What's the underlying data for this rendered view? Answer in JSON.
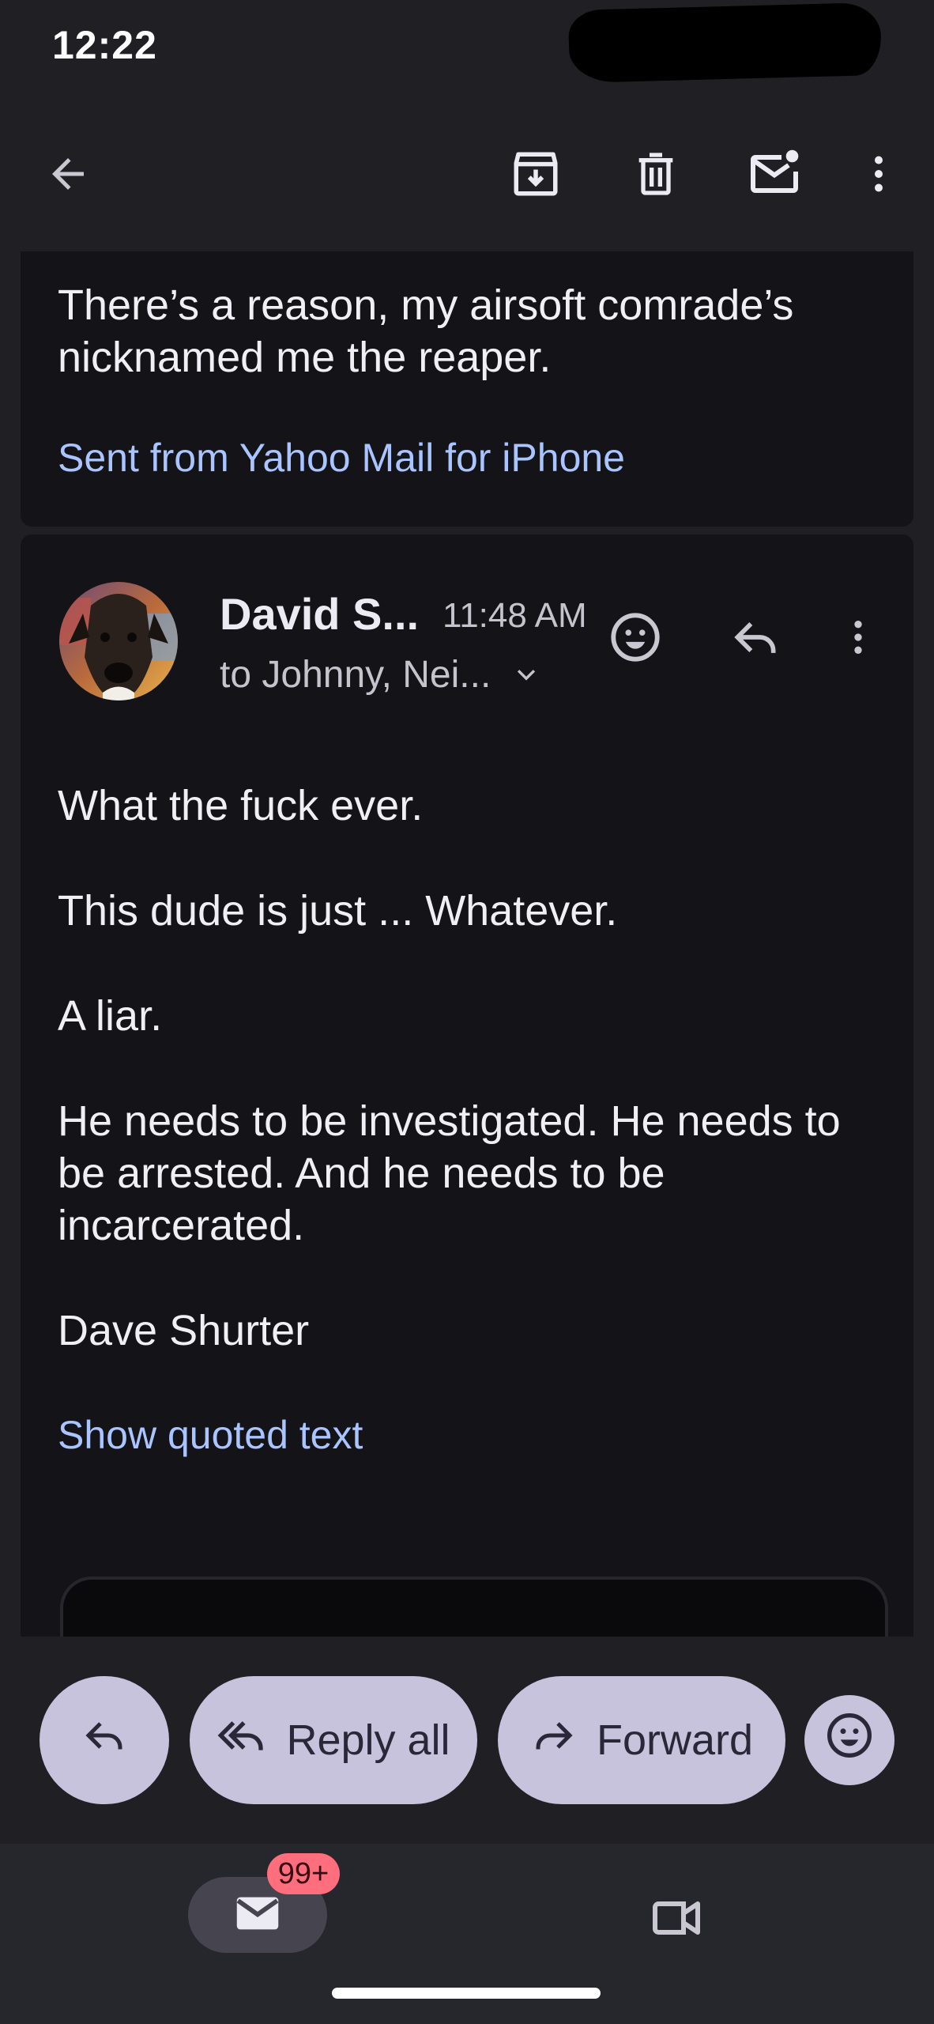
{
  "status_bar": {
    "time": "12:22"
  },
  "toolbar": {
    "icons": [
      "back-arrow-icon",
      "archive-icon",
      "trash-icon",
      "mark-unread-icon",
      "more-vert-icon"
    ]
  },
  "previous_message": {
    "body_line1": "There’s a reason, my airsoft comrade’s",
    "body_line2": "nicknamed me the reaper.",
    "signature_link": "Sent from Yahoo Mail for iPhone"
  },
  "message": {
    "sender_name": "David S...",
    "time": "11:48 AM",
    "recipients": "to Johnny, Nei...",
    "body": [
      "What the fuck ever.",
      "This dude is just ... Whatever.",
      "A liar.",
      "He needs to be investigated. He needs to",
      "be arrested. And he needs to be",
      "incarcerated.",
      "Dave Shurter"
    ],
    "show_quoted_text": "Show quoted text"
  },
  "actions": {
    "reply_all_label": "Reply all",
    "forward_label": "Forward"
  },
  "bottom_nav": {
    "mail_badge": "99+"
  },
  "colors": {
    "background": "#1f1f24",
    "card": "#131318",
    "link": "#a9c4ff",
    "pill": "#c8c3dd",
    "badge": "#ff6e7c"
  }
}
